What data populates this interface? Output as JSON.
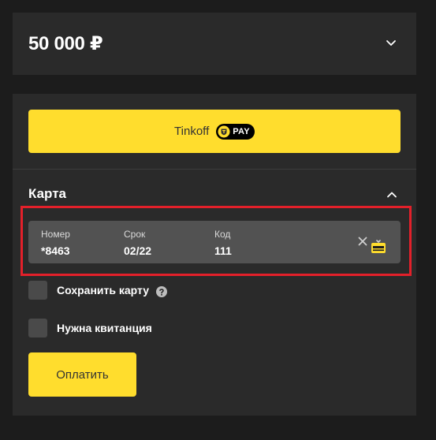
{
  "amount": {
    "value": "50 000 ₽",
    "chevron_icon": "chevron-down-icon"
  },
  "tpay": {
    "label": "Tinkoff",
    "badge_text": "PAY",
    "badge_icon": "tinkoff-shield-icon"
  },
  "card_section": {
    "title": "Карта",
    "chevron_icon": "chevron-up-icon"
  },
  "card_form": {
    "number_label": "Номер",
    "number_value": "*8463",
    "expiry_label": "Срок",
    "expiry_value": "02/22",
    "cvc_label": "Код",
    "cvc_value": "111",
    "clear_icon": "close-icon",
    "card_type_icon": "card-icon"
  },
  "options": {
    "save_card_label": "Сохранить карту",
    "save_card_checked": false,
    "help_icon": "question-icon",
    "receipt_label": "Нужна квитанция",
    "receipt_checked": false
  },
  "submit": {
    "label": "Оплатить"
  },
  "colors": {
    "background": "#1c1c1c",
    "panel": "#2a2a2a",
    "accent_yellow": "#ffdd2d",
    "input_bg": "#525252",
    "highlight_red": "#e3202a"
  }
}
